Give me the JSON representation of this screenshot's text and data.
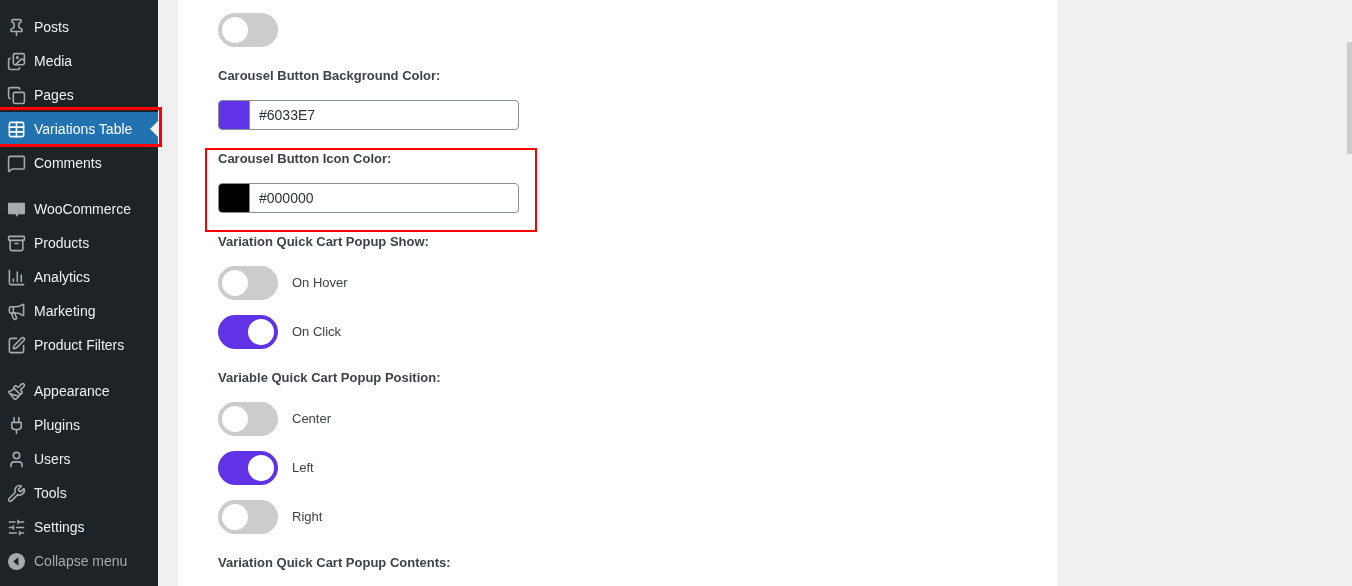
{
  "sidebar": {
    "groups": [
      {
        "items": [
          {
            "label": "Posts",
            "selected": false,
            "highlighted": false
          },
          {
            "label": "Media",
            "selected": false,
            "highlighted": false
          },
          {
            "label": "Pages",
            "selected": false,
            "highlighted": false
          },
          {
            "label": "Variations Table",
            "selected": true,
            "highlighted": true
          },
          {
            "label": "Comments",
            "selected": false,
            "highlighted": false
          }
        ]
      },
      {
        "items": [
          {
            "label": "WooCommerce",
            "selected": false,
            "highlighted": false
          },
          {
            "label": "Products",
            "selected": false,
            "highlighted": false
          },
          {
            "label": "Analytics",
            "selected": false,
            "highlighted": false
          },
          {
            "label": "Marketing",
            "selected": false,
            "highlighted": false
          },
          {
            "label": "Product Filters",
            "selected": false,
            "highlighted": false
          }
        ]
      },
      {
        "items": [
          {
            "label": "Appearance",
            "selected": false,
            "highlighted": false
          },
          {
            "label": "Plugins",
            "selected": false,
            "highlighted": false
          },
          {
            "label": "Users",
            "selected": false,
            "highlighted": false
          },
          {
            "label": "Tools",
            "selected": false,
            "highlighted": false
          },
          {
            "label": "Settings",
            "selected": false,
            "highlighted": false
          }
        ]
      }
    ],
    "collapse_button": "Collapse menu"
  },
  "settings": [
    {
      "highlighted": false,
      "controls": [
        {
          "kind": "toggle",
          "on": false
        }
      ]
    },
    {
      "heading": "Carousel Button Background Color:",
      "highlighted": false,
      "controls": [
        {
          "kind": "color",
          "value": "#6033E7",
          "color": "#6033e7"
        }
      ]
    },
    {
      "heading": "Carousel Button Icon Color:",
      "highlighted": true,
      "controls": [
        {
          "kind": "color",
          "value": "#000000",
          "color": "#000000"
        }
      ]
    },
    {
      "heading": "Variation Quick Cart Popup Show:",
      "highlighted": false,
      "controls": [
        {
          "kind": "toggle",
          "on": false,
          "label": "On Hover"
        },
        {
          "kind": "toggle",
          "on": true,
          "label": "On Click"
        }
      ]
    },
    {
      "heading": "Variable Quick Cart Popup Position:",
      "highlighted": false,
      "controls": [
        {
          "kind": "toggle",
          "on": false,
          "label": "Center"
        },
        {
          "kind": "toggle",
          "on": true,
          "label": "Left"
        },
        {
          "kind": "toggle",
          "on": false,
          "label": "Right"
        }
      ]
    },
    {
      "heading": "Variation Quick Cart Popup Contents:",
      "highlighted": false
    }
  ]
}
